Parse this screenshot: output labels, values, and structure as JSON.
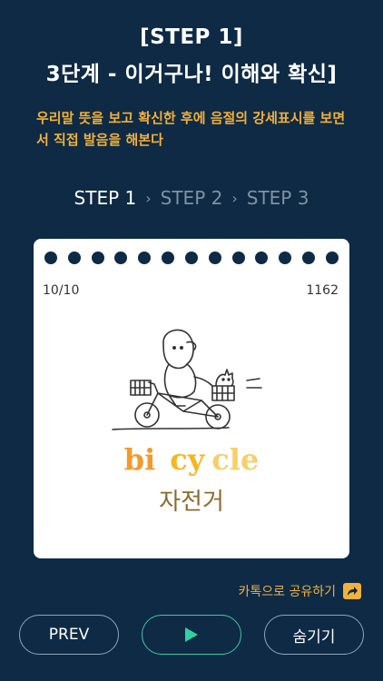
{
  "header": {
    "title_line1": "[STEP 1]",
    "title_line2": "3단계 - 이거구나! 이해와 확신]",
    "description": "우리말 뜻을 보고 확신한 후에 음절의 강세표시를 보면서 직접 발음을 해본다"
  },
  "steps": [
    {
      "label": "STEP 1",
      "active": true
    },
    {
      "label": "STEP 2",
      "active": false
    },
    {
      "label": "STEP 3",
      "active": false
    }
  ],
  "card": {
    "progress": "10/10",
    "number": "1162",
    "syllables": [
      "bi",
      "cy",
      "cle"
    ],
    "meaning": "자전거",
    "illustration": "bicycle-cartoon"
  },
  "share": {
    "label": "카톡으로 공유하기",
    "icon": "share-arrow-icon"
  },
  "buttons": {
    "prev": "PREV",
    "play_icon": "play-icon",
    "hide": "숨기기"
  },
  "colors": {
    "background": "#0e2a45",
    "accent": "#f2b13a",
    "play": "#2fd39f"
  }
}
